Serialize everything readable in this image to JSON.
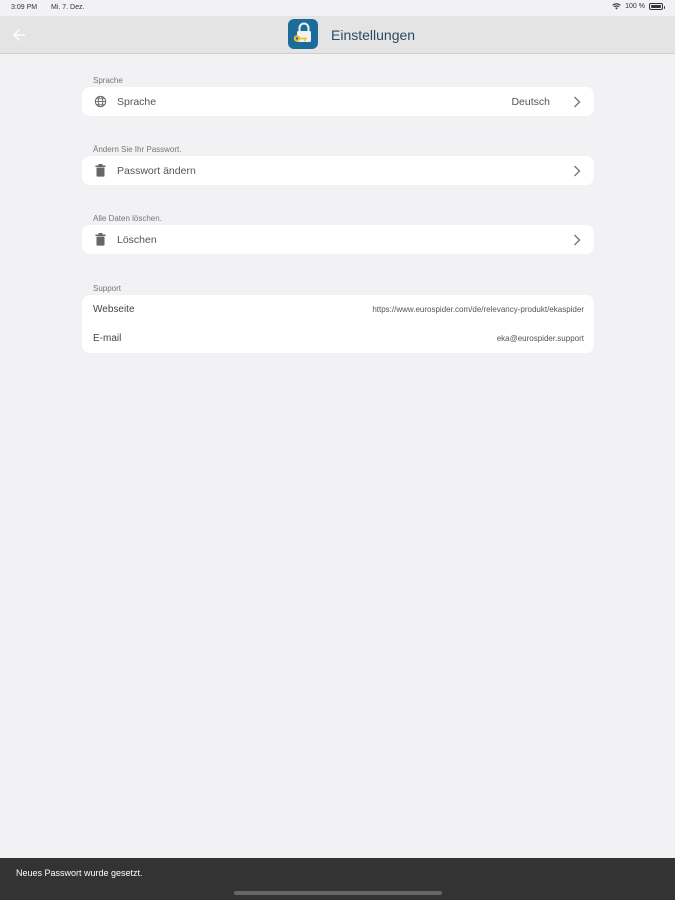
{
  "status_bar": {
    "time": "3:09 PM",
    "date": "Mi. 7. Dez.",
    "battery": "100 %"
  },
  "app_bar": {
    "title": "Einstellungen",
    "brand_color": "#1b6c9a"
  },
  "sections": {
    "language": {
      "header": "Sprache",
      "row_label": "Sprache",
      "row_value": "Deutsch"
    },
    "password": {
      "header": "Ändern Sie Ihr Passwort.",
      "row_label": "Passwort ändern"
    },
    "delete": {
      "header": "Alle Daten löschen.",
      "row_label": "Löschen"
    },
    "support": {
      "header": "Support",
      "website_label": "Webseite",
      "website_value": "https://www.eurospider.com/de/relevancy-produkt/ekaspider",
      "email_label": "E-mail",
      "email_value": "eka@eurospider.support"
    }
  },
  "snackbar": {
    "message": "Neues Passwort wurde gesetzt."
  }
}
